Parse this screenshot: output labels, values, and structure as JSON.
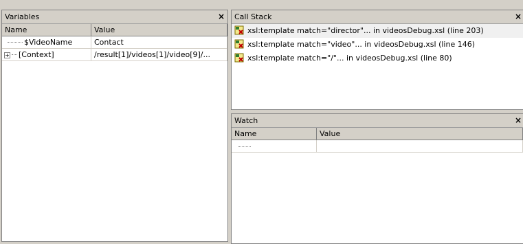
{
  "variables": {
    "title": "Variables",
    "close": "×",
    "columns": [
      "Name",
      "Value"
    ],
    "rows": [
      {
        "name": "$VideoName",
        "value": "Contact"
      },
      {
        "name": "[Context]",
        "value": "/result[1]/videos[1]/video[9]/..."
      }
    ]
  },
  "callstack": {
    "title": "Call Stack",
    "close": "×",
    "items": [
      {
        "label": "xsl:template match=\"director\"... in videosDebug.xsl (line 203)"
      },
      {
        "label": "xsl:template match=\"video\"... in videosDebug.xsl (line 146)"
      },
      {
        "label": "xsl:template match=\"/\"... in videosDebug.xsl (line 80)"
      }
    ]
  },
  "watch": {
    "title": "Watch",
    "close": "×",
    "columns": [
      "Name",
      "Value"
    ]
  },
  "icons": {
    "expander": "plus-expander-icon",
    "template": "xsl-template-icon"
  }
}
